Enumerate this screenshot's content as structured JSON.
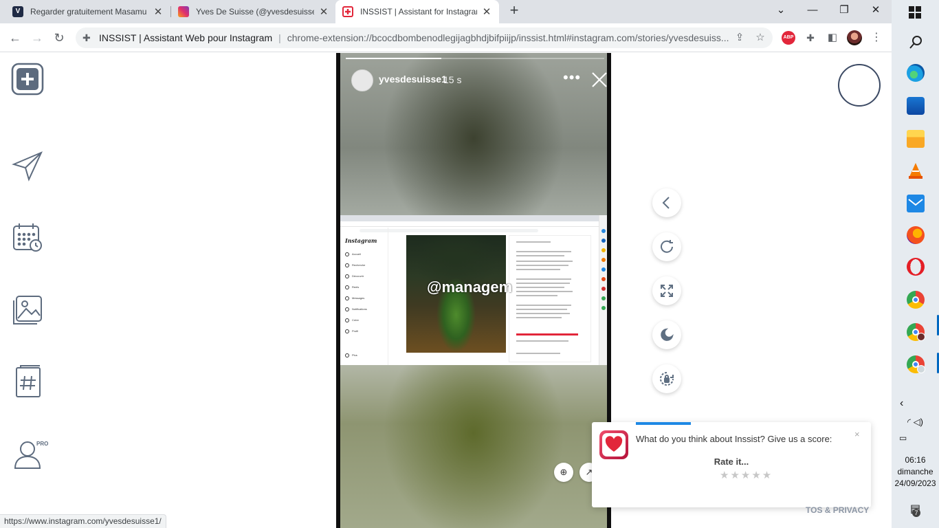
{
  "browser": {
    "tabs": [
      {
        "title": "Regarder gratuitement Masamu"
      },
      {
        "title": "Yves De Suisse (@yvesdesuisse1"
      },
      {
        "title": "INSSIST | Assistant for Instagram"
      }
    ],
    "new_tab": "+",
    "address": {
      "ext_name": "INSSIST | Assistant Web pour Instagram",
      "url": "chrome-extension://bcocdbombenodlegijagbhdjbifpiijp/inssist.html#instagram.com/stories/yvesdesuiss..."
    },
    "abp_label": "ABP",
    "status_url": "https://www.instagram.com/yvesdesuisse1/"
  },
  "sidebar": {
    "items": [
      {
        "icon": "add-post-icon"
      },
      {
        "icon": "direct-message-icon"
      },
      {
        "icon": "schedule-calendar-icon"
      },
      {
        "icon": "media-gallery-icon"
      },
      {
        "icon": "hashtag-book-icon"
      },
      {
        "icon": "account-pro-icon"
      }
    ],
    "pro_badge": "PRO"
  },
  "story": {
    "progress": 0.37,
    "username": "yvesdesuisse1",
    "time": "15 s",
    "more_label": "•••",
    "screenshot": {
      "logo": "Instagram",
      "menu": [
        "Accueil",
        "Recherche",
        "Découvrir",
        "Reels",
        "Messages",
        "Notifications",
        "Créer",
        "Profil",
        "Plus"
      ],
      "watermark": "@managem"
    }
  },
  "rating": {
    "question": "What do you think about Inssist? Give us a score:",
    "rate_label": "Rate it...",
    "stars": "★★★★★",
    "close": "×"
  },
  "footer": {
    "tos": "TOS & PRIVACY"
  },
  "taskbar": {
    "time": "06:16",
    "day": "dimanche",
    "date": "24/09/2023",
    "notifications": "7"
  },
  "colors": {
    "accent": "#1e88e5",
    "icon": "#5d6b7e",
    "brand_heart": "#e2263a"
  }
}
